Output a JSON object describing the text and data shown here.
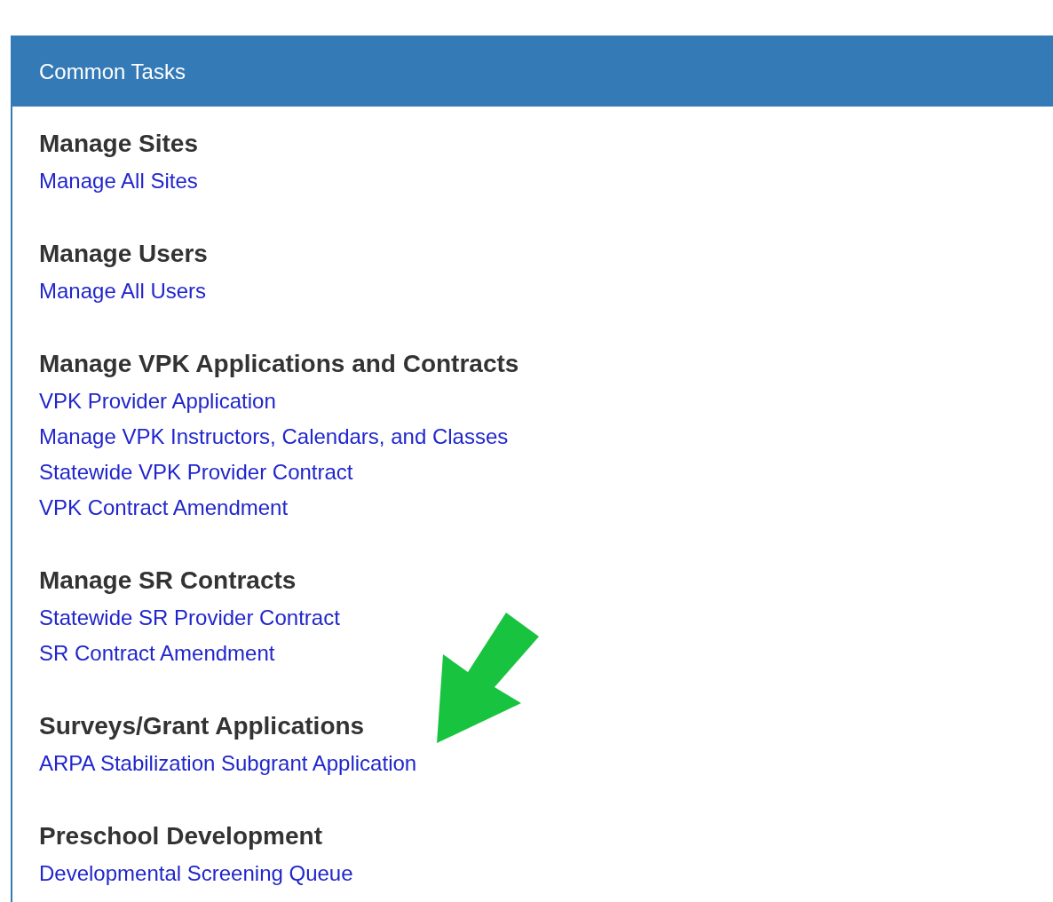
{
  "panel": {
    "title": "Common Tasks"
  },
  "sections": [
    {
      "heading": "Manage Sites",
      "links": [
        "Manage All Sites"
      ]
    },
    {
      "heading": "Manage Users",
      "links": [
        "Manage All Users"
      ]
    },
    {
      "heading": "Manage VPK Applications and Contracts",
      "links": [
        "VPK Provider Application",
        "Manage VPK Instructors, Calendars, and Classes",
        "Statewide VPK Provider Contract",
        "VPK Contract Amendment"
      ]
    },
    {
      "heading": "Manage SR Contracts",
      "links": [
        "Statewide SR Provider Contract",
        "SR Contract Amendment"
      ]
    },
    {
      "heading": "Surveys/Grant Applications",
      "links": [
        "ARPA Stabilization Subgrant Application"
      ]
    },
    {
      "heading": "Preschool Development",
      "links": [
        "Developmental Screening Queue"
      ]
    }
  ]
}
